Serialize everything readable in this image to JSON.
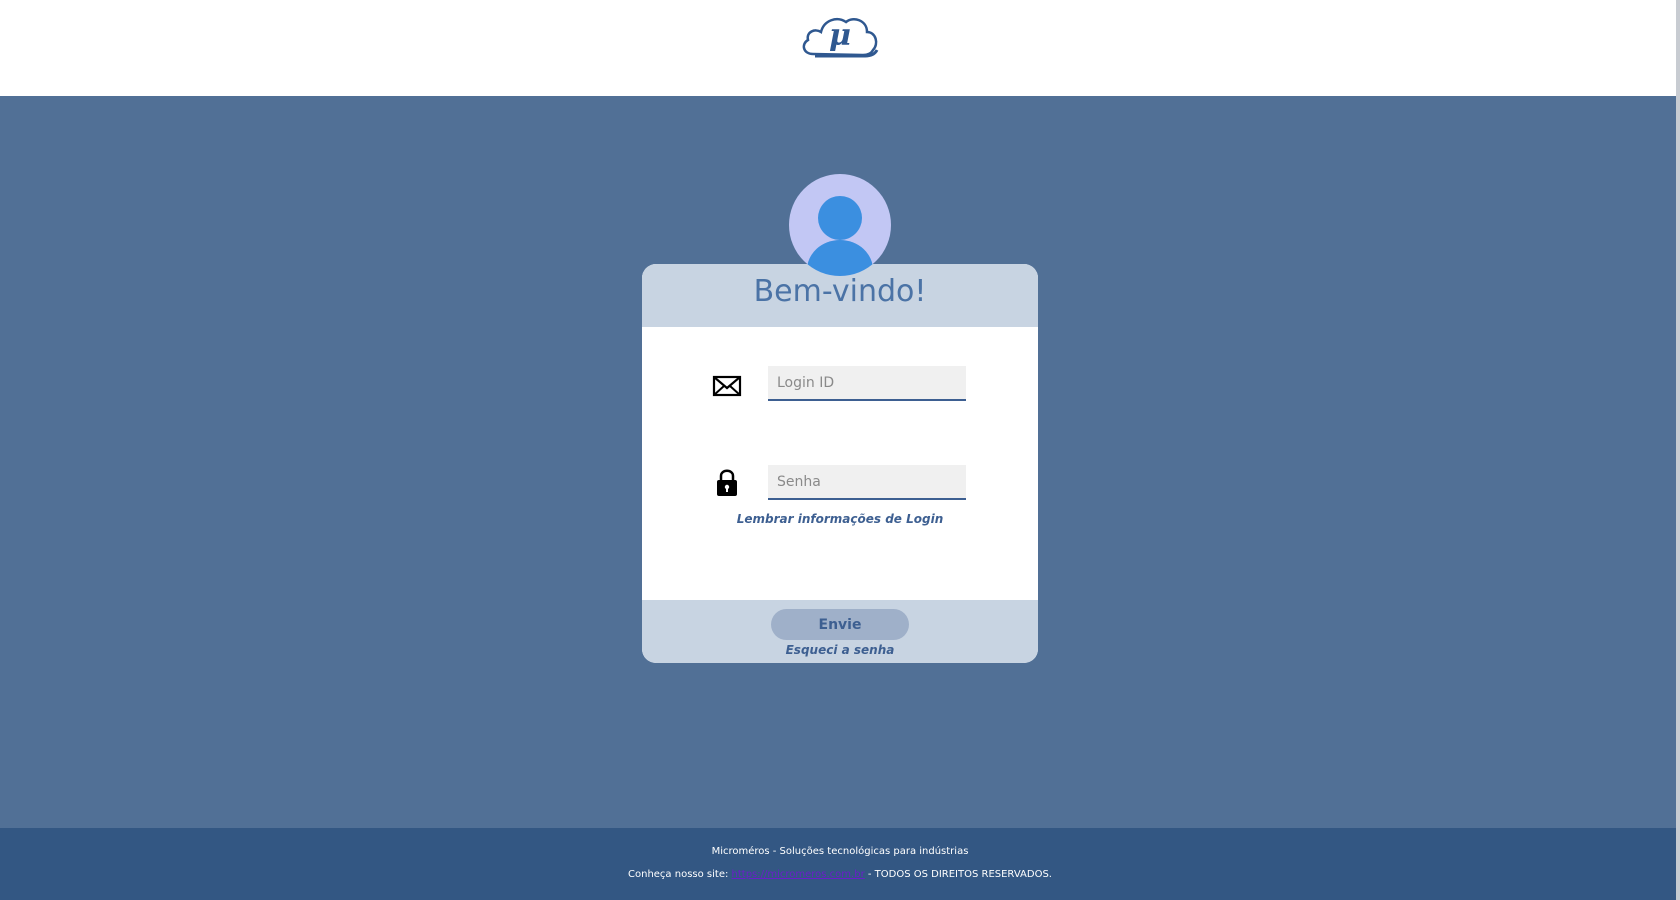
{
  "header": {
    "logo_icon": "micromeros-cloud-mu-logo"
  },
  "login": {
    "avatar_icon": "user-avatar-icon",
    "title": "Bem-vindo!",
    "login_placeholder": "Login ID",
    "login_value": "",
    "password_placeholder": "Senha",
    "password_value": "",
    "email_icon": "envelope-icon",
    "password_icon": "lock-icon",
    "remember_label": "Lembrar informações de Login",
    "submit_label": "Envie",
    "forgot_label": "Esqueci a senha"
  },
  "footer": {
    "line1": "Microméros - Soluções tecnológicas para indústrias",
    "line2_prefix": "Conheça nosso site: ",
    "link_text": "https://micromeros.com.br",
    "line2_suffix": " - TODOS OS DIREITOS RESERVADOS."
  },
  "colors": {
    "background": "#517096",
    "header": "#ffffff",
    "card_band": "#c8d4e2",
    "accent": "#3d5f91",
    "footer": "#335783",
    "avatar_bg": "#c2c7f4",
    "avatar_figure": "#3b8fe0"
  }
}
